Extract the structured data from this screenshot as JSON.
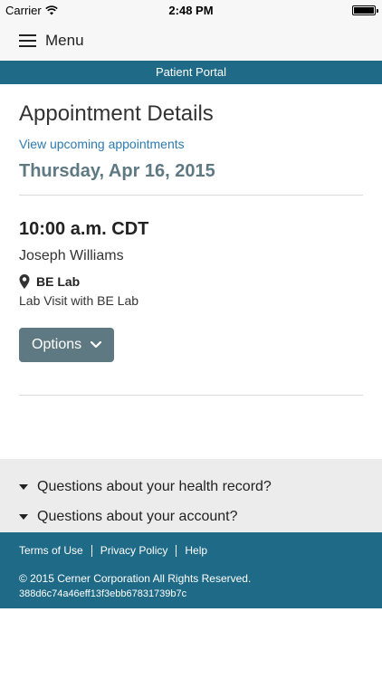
{
  "status_bar": {
    "carrier": "Carrier",
    "time": "2:48 PM"
  },
  "nav": {
    "menu_label": "Menu"
  },
  "banner": {
    "title": "Patient Portal"
  },
  "page": {
    "title": "Appointment Details",
    "upcoming_link": "View upcoming appointments",
    "date": "Thursday, Apr 16, 2015"
  },
  "appointment": {
    "time": "10:00 a.m. CDT",
    "provider": "Joseph Williams",
    "location": "BE Lab",
    "visit_type": "Lab Visit with BE Lab",
    "options_label": "Options"
  },
  "faq": {
    "items": [
      {
        "label": "Questions about your health record?"
      },
      {
        "label": "Questions about your account?"
      }
    ]
  },
  "footer": {
    "links": [
      {
        "label": "Terms of Use"
      },
      {
        "label": "Privacy Policy"
      },
      {
        "label": "Help"
      }
    ],
    "copyright": "© 2015 Cerner Corporation All Rights Reserved.",
    "build_id": "388d6c74a46eff13f3ebb67831739b7c"
  },
  "colors": {
    "banner": "#1f6a86",
    "accent_link": "#2d7bb0",
    "date_text": "#5f7983",
    "button": "#5f7983"
  }
}
